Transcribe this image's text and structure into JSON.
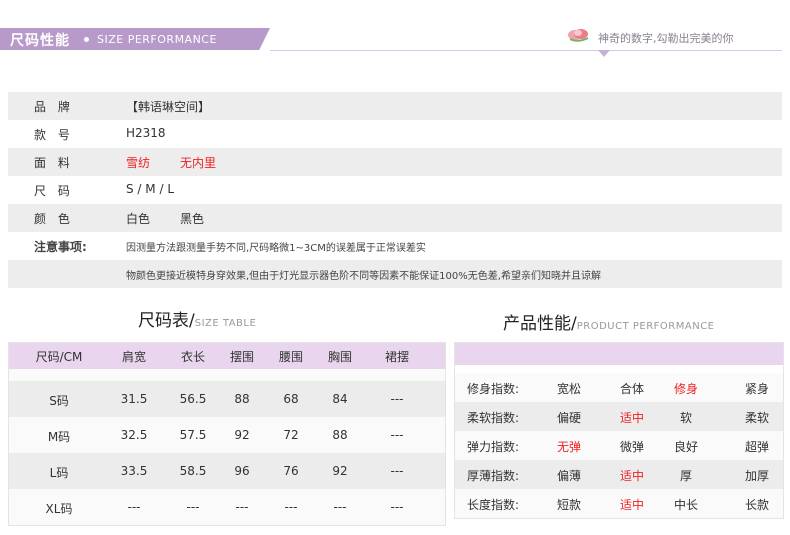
{
  "header": {
    "title": "尺码性能",
    "subtitle": "SIZE PERFORMANCE",
    "slogan": "神奇的数字,勾勒出完美的你",
    "accent": "#b79ac9"
  },
  "specs": [
    {
      "label": "品 牌",
      "values": [
        "【韩语琳空间】"
      ],
      "highlight": false
    },
    {
      "label": "款 号",
      "values": [
        "H2318"
      ],
      "highlight": false
    },
    {
      "label": "面 料",
      "values": [
        "雪纺",
        "无内里"
      ],
      "highlight": true
    },
    {
      "label": "尺 码",
      "values": [
        "S / M / L"
      ],
      "highlight": false
    },
    {
      "label": "颜 色",
      "values": [
        "白色",
        "黑色"
      ],
      "highlight": false
    }
  ],
  "notice": {
    "label": "注意事项:",
    "lines": [
      "因测量方法跟测量手势不同,尺码略微1~3CM的误差属于正常误差实",
      "物颜色更接近模特身穿效果,但由于灯光显示器色阶不同等因素不能保证100%无色差,希望亲们知晓并且谅解"
    ]
  },
  "size_table": {
    "title": "尺码表/",
    "title_sub": "SIZE TABLE",
    "columns": [
      "尺码/CM",
      "肩宽",
      "衣长",
      "摆围",
      "腰围",
      "胸围",
      "裙摆"
    ],
    "rows": [
      [
        "S码",
        "31.5",
        "56.5",
        "88",
        "68",
        "84",
        "---"
      ],
      [
        "M码",
        "32.5",
        "57.5",
        "92",
        "72",
        "88",
        "---"
      ],
      [
        "L码",
        "33.5",
        "58.5",
        "96",
        "76",
        "92",
        "---"
      ],
      [
        "XL码",
        "---",
        "---",
        "---",
        "---",
        "---",
        "---"
      ]
    ]
  },
  "performance": {
    "title": "产品性能/",
    "title_sub": "PRODUCT PERFORMANCE",
    "rows": [
      {
        "label": "修身指数:",
        "options": [
          "宽松",
          "合体",
          "修身",
          "紧身"
        ],
        "selected": 2
      },
      {
        "label": "柔软指数:",
        "options": [
          "偏硬",
          "适中",
          "软",
          "柔软"
        ],
        "selected": 1
      },
      {
        "label": "弹力指数:",
        "options": [
          "无弹",
          "微弹",
          "良好",
          "超弹"
        ],
        "selected": 0
      },
      {
        "label": "厚薄指数:",
        "options": [
          "偏薄",
          "适中",
          "厚",
          "加厚"
        ],
        "selected": 1
      },
      {
        "label": "长度指数:",
        "options": [
          "短款",
          "适中",
          "中长",
          "长款"
        ],
        "selected": 1
      }
    ],
    "selected_color": "#ee2222"
  }
}
